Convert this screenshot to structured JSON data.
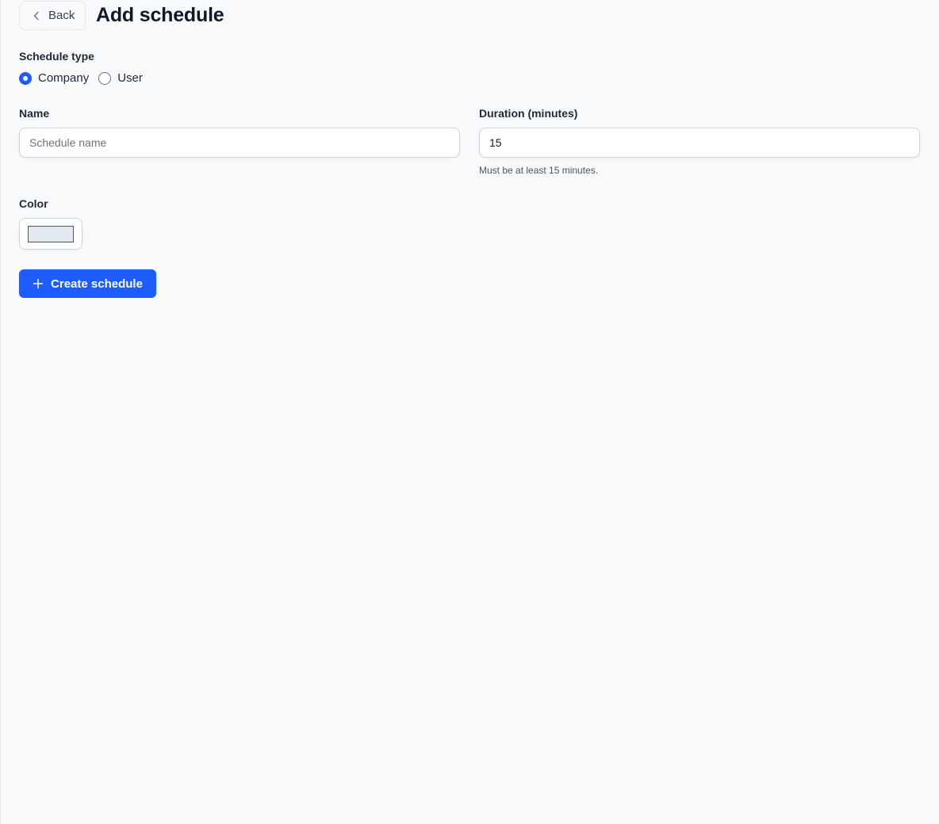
{
  "header": {
    "back_label": "Back",
    "title": "Add schedule"
  },
  "schedule_type": {
    "label": "Schedule type",
    "options": [
      {
        "label": "Company",
        "checked": true
      },
      {
        "label": "User",
        "checked": false
      }
    ]
  },
  "name_field": {
    "label": "Name",
    "value": "",
    "placeholder": "Schedule name"
  },
  "duration_field": {
    "label": "Duration (minutes)",
    "value": "15",
    "hint": "Must be at least 15 minutes."
  },
  "color_field": {
    "label": "Color",
    "value": "#e2e8f0"
  },
  "actions": {
    "create_label": "Create schedule",
    "accent": "#1d5cff"
  }
}
